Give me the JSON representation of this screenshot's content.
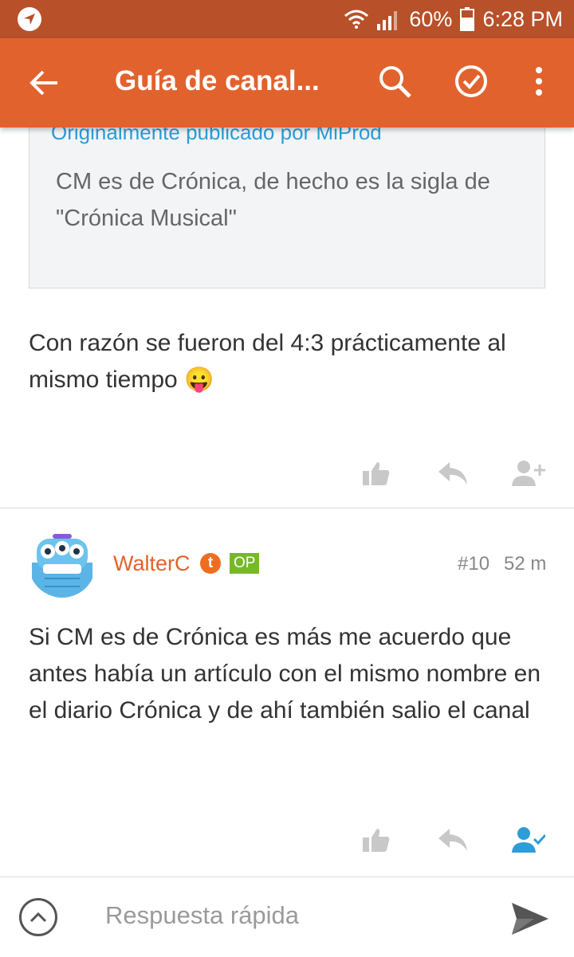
{
  "status_bar": {
    "battery": "60%",
    "time": "6:28 PM"
  },
  "app_bar": {
    "title": "Guía de canal..."
  },
  "quote": {
    "author_line": "Originalmente publicado por MiProd",
    "text": "CM es de Crónica, de hecho es la sigla de \"Crónica Musical\""
  },
  "post1": {
    "text": "Con razón se fueron del 4:3 prácticamente al mismo tiempo 😛"
  },
  "post2": {
    "username": "WalterC",
    "badge_t": "t",
    "badge_op": "OP",
    "post_number": "#10",
    "time_ago": "52 m",
    "text": "Si CM es de Crónica es más me acuerdo que antes había un artículo con el mismo nombre en el diario Crónica y de ahí también salio el canal"
  },
  "reply_bar": {
    "placeholder": "Respuesta rápida"
  },
  "colors": {
    "status_bar": "#b8502a",
    "app_bar": "#e2622d",
    "accent_blue": "#2b9ed8",
    "icon_gray": "#c8c8c8"
  }
}
